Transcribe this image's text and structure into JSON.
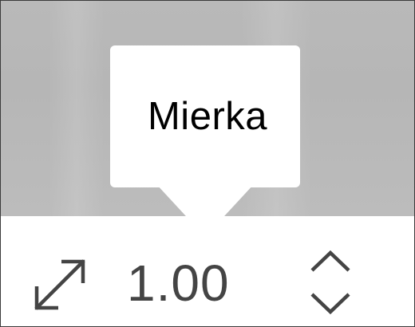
{
  "tooltip": {
    "text": "Mierka"
  },
  "scale_control": {
    "value": "1.00",
    "icons": {
      "resize": "diagonal-resize-icon",
      "increase": "chevron-up-icon",
      "decrease": "chevron-down-icon"
    }
  },
  "colors": {
    "backdrop": "#b9b9b9",
    "tooltip_background": "#ffffff",
    "tooltip_text": "#000000",
    "bar_background": "#ffffff",
    "value_text": "#444444",
    "icon_stroke": "#444444"
  }
}
